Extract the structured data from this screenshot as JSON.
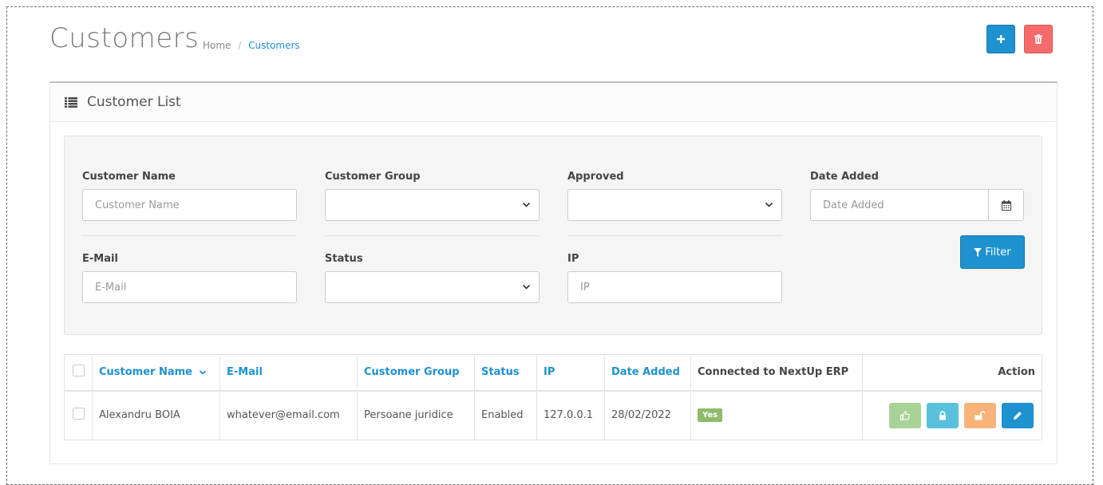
{
  "header": {
    "title": "Customers",
    "breadcrumb": {
      "home": "Home",
      "separator": "/",
      "current": "Customers"
    }
  },
  "panel": {
    "title": "Customer List"
  },
  "filter": {
    "customer_name": {
      "label": "Customer Name",
      "placeholder": "Customer Name"
    },
    "customer_group": {
      "label": "Customer Group",
      "selected": ""
    },
    "approved": {
      "label": "Approved",
      "selected": ""
    },
    "date_added": {
      "label": "Date Added",
      "placeholder": "Date Added"
    },
    "email": {
      "label": "E-Mail",
      "placeholder": "E-Mail"
    },
    "status": {
      "label": "Status",
      "selected": ""
    },
    "ip": {
      "label": "IP",
      "placeholder": "IP"
    },
    "filter_button": "Filter"
  },
  "table": {
    "columns": {
      "customer_name": "Customer Name",
      "email": "E-Mail",
      "customer_group": "Customer Group",
      "status": "Status",
      "ip": "IP",
      "date_added": "Date Added",
      "connected": "Connected to NextUp ERP",
      "action": "Action"
    },
    "rows": [
      {
        "customer_name": "Alexandru BOIA",
        "email": "whatever@email.com",
        "customer_group": "Persoane juridice",
        "status": "Enabled",
        "ip": "127.0.0.1",
        "date_added": "28/02/2022",
        "connected": "Yes"
      }
    ]
  },
  "icons": {
    "add": "plus-icon",
    "delete": "trash-icon",
    "list": "list-icon",
    "calendar": "calendar-icon",
    "filter": "filter-icon",
    "sort": "chevron-down-icon",
    "approve": "thumbs-up-icon",
    "lock": "lock-icon",
    "unlock": "unlock-icon",
    "edit": "pencil-icon"
  },
  "colors": {
    "primary": "#1e91cf",
    "danger": "#f56b6b",
    "success": "#8fbb6c",
    "info": "#5bc0de",
    "warning": "#f7b37a"
  }
}
